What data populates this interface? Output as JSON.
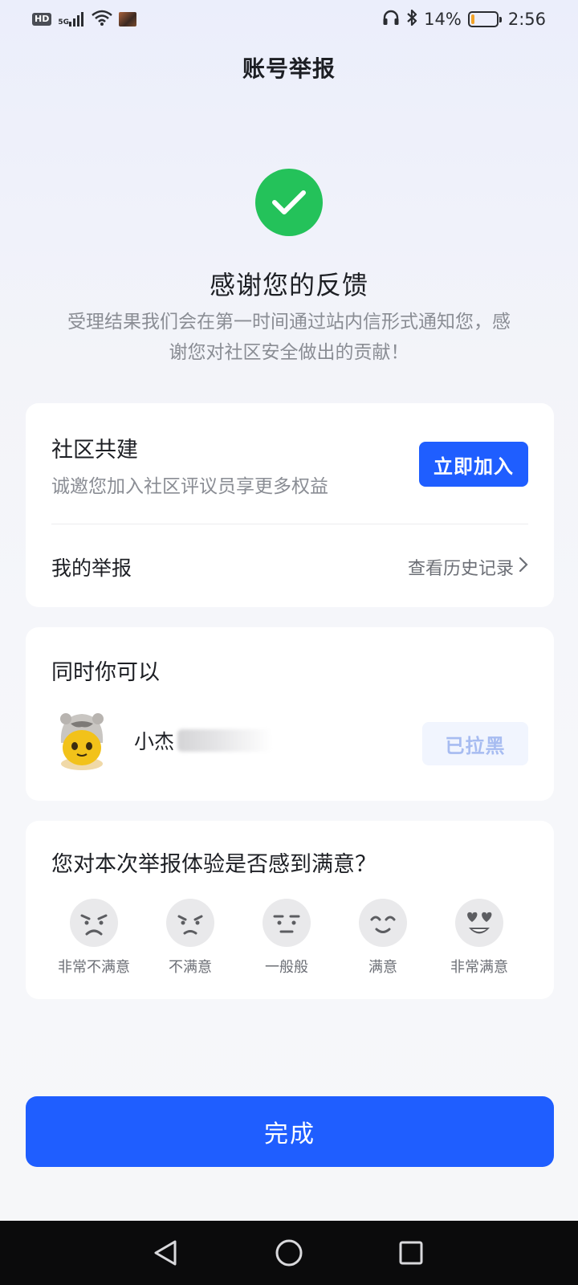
{
  "status_bar": {
    "network": "5G",
    "hd": "HD",
    "battery_percent": "14%",
    "battery_level": 0.14,
    "time": "2:56",
    "icons": [
      "headphones-icon",
      "bluetooth-icon",
      "wifi-icon",
      "signal-icon"
    ]
  },
  "header": {
    "title": "账号举报"
  },
  "success": {
    "icon": "check-icon",
    "title": "感谢您的反馈",
    "description": "受理结果我们会在第一时间通过站内信形式通知您，感谢您对社区安全做出的贡献！"
  },
  "community": {
    "title": "社区共建",
    "subtitle": "诚邀您加入社区评议员享更多权益",
    "join_button": "立即加入",
    "my_report_label": "我的举报",
    "history_link": "查看历史记录"
  },
  "also": {
    "title": "同时你可以",
    "user_name_visible": "小杰",
    "blocked_button": "已拉黑"
  },
  "survey": {
    "question": "您对本次举报体验是否感到满意？",
    "options": [
      {
        "label": "非常不满意",
        "icon": "very-unsatisfied-face-icon"
      },
      {
        "label": "不满意",
        "icon": "unsatisfied-face-icon"
      },
      {
        "label": "一般般",
        "icon": "neutral-face-icon"
      },
      {
        "label": "满意",
        "icon": "satisfied-face-icon"
      },
      {
        "label": "非常满意",
        "icon": "very-satisfied-face-icon"
      }
    ]
  },
  "footer": {
    "done_button": "完成"
  },
  "colors": {
    "accent": "#1f5eff",
    "success": "#24c25a",
    "muted_text": "#8a8d94"
  }
}
